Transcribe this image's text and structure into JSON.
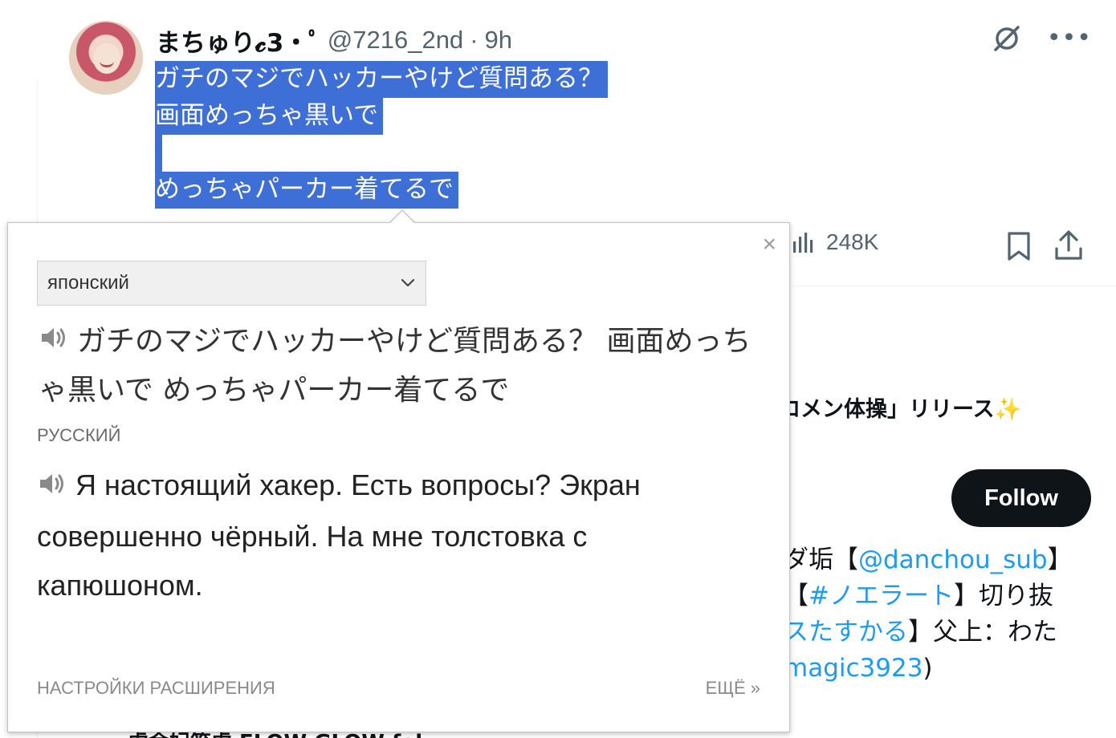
{
  "tweet": {
    "display_name": "まちゅり𝓬3·ﾟ",
    "handle": "@7216_2nd",
    "separator": "·",
    "time": "9h",
    "text_lines": [
      "ガチのマジでハッカーやけど質問ある？",
      "画面めっちゃ黒いで",
      "",
      "めっちゃパーカー着てるで"
    ],
    "views": "248K",
    "more_label": "•••"
  },
  "sidebar": {
    "promo_text": "ロメン体操」リリース",
    "follow_label": "Follow",
    "bio": {
      "line1_prefix": "ダ垢【",
      "line1_link": "@danchou_sub",
      "line1_suffix": "】",
      "line2_prefix": "【",
      "line2_link": "#ノエラート",
      "line2_suffix": "】切り抜",
      "line3_link": "スたすかる",
      "line3_suffix": "】父上：わた",
      "line4_link": "magic3923",
      "line4_suffix": ")"
    },
    "peek_text": "· 虎金妃笑虎   FLOW GLOW fol"
  },
  "popup": {
    "close_label": "×",
    "source_language": "японский",
    "source_text": "ガチのマジでハッカーやけど質問ある？ 画面めっちゃ黒いで めっちゃパーカー着てるで",
    "target_language": "РУССКИЙ",
    "translation": "Я настоящий хакер. Есть вопросы? Экран совершенно чёрный. На мне толстовка с капюшоном.",
    "settings_label": "НАСТРОЙКИ РАСШИРЕНИЯ",
    "more_label": "ЕЩЁ »"
  },
  "colors": {
    "selection": "#3d6fd6",
    "link": "#1d9bf0",
    "follow_bg": "#0f1419",
    "muted": "#536471"
  },
  "icons": [
    "grok-icon",
    "more-icon",
    "views-icon",
    "bookmark-icon",
    "share-icon",
    "speaker-icon",
    "chevron-down-icon",
    "close-icon"
  ]
}
